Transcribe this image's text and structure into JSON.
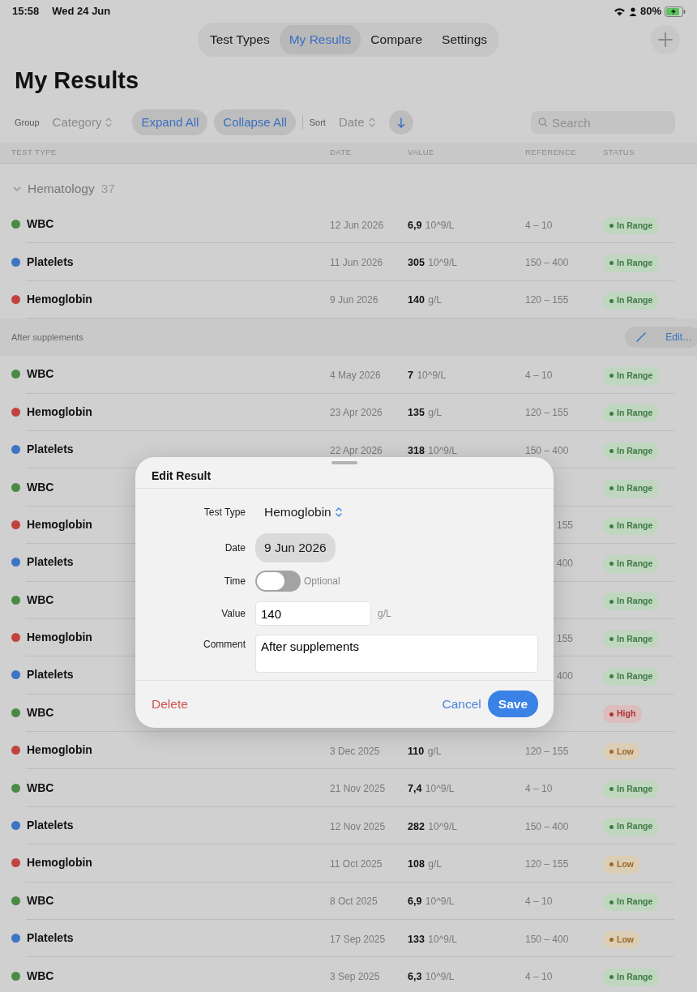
{
  "status_bar": {
    "time": "15:58",
    "date": "Wed 24 Jun",
    "battery": "80%"
  },
  "tabs": [
    {
      "label": "Test Types",
      "selected": false
    },
    {
      "label": "My Results",
      "selected": true
    },
    {
      "label": "Compare",
      "selected": false
    },
    {
      "label": "Settings",
      "selected": false
    }
  ],
  "page_title": "My Results",
  "toolbar": {
    "group_label": "Group",
    "group_value": "Category",
    "expand": "Expand All",
    "collapse": "Collapse All",
    "sort_label": "Sort",
    "sort_value": "Date",
    "search_placeholder": "Search"
  },
  "columns": [
    "TEST TYPE",
    "DATE",
    "VALUE",
    "REFERENCE",
    "STATUS"
  ],
  "group": {
    "name": "Hematology",
    "count": "37",
    "expanded": true
  },
  "rows": [
    {
      "kind": "full",
      "test": "WBC",
      "color": "#4a8a45",
      "date": "12 Jun 2026",
      "value": "6,9",
      "unit": "10^9/L",
      "reference": "4 – 10",
      "status": {
        "label": "In Range",
        "kind": "ok"
      }
    },
    {
      "kind": "full",
      "test": "Platelets",
      "color": "#3d74c4",
      "date": "11 Jun 2026",
      "value": "305",
      "unit": "10^9/L",
      "reference": "150 – 400",
      "status": {
        "label": "In Range",
        "kind": "ok"
      }
    },
    {
      "kind": "full",
      "test": "Hemoglobin",
      "color": "#c0443d",
      "date": "9 Jun 2026",
      "value": "140",
      "unit": "g/L",
      "reference": "120 – 155",
      "status": {
        "label": "In Range",
        "kind": "ok"
      },
      "note": {
        "text": "After supplements",
        "button": "Edit…"
      }
    },
    {
      "kind": "full",
      "test": "WBC",
      "color": "#4a8a45",
      "date": "4 May 2026",
      "value": "7",
      "unit": "10^9/L",
      "reference": "4 – 10",
      "status": {
        "label": "In Range",
        "kind": "ok"
      }
    },
    {
      "kind": "full",
      "test": "Hemoglobin",
      "color": "#c0443d",
      "date": "23 Apr 2026",
      "value": "135",
      "unit": "g/L",
      "reference": "120 – 155",
      "status": {
        "label": "In Range",
        "kind": "ok"
      }
    },
    {
      "kind": "full",
      "test": "Platelets",
      "color": "#3d74c4",
      "date": "22 Apr 2026",
      "value": "318",
      "unit": "10^9/L",
      "reference": "150 – 400",
      "status": {
        "label": "In Range",
        "kind": "ok"
      }
    },
    {
      "kind": "covered",
      "test": "WBC",
      "color": "#4a8a45",
      "status": {
        "label": "In Range",
        "kind": "ok"
      }
    },
    {
      "kind": "covered",
      "test": "Hemoglobin",
      "color": "#c0443d",
      "reference": "155",
      "status": {
        "label": "In Range",
        "kind": "ok"
      }
    },
    {
      "kind": "covered",
      "test": "Platelets",
      "color": "#3d74c4",
      "reference": "400",
      "status": {
        "label": "In Range",
        "kind": "ok"
      }
    },
    {
      "kind": "covered",
      "test": "WBC",
      "color": "#4a8a45",
      "status": {
        "label": "In Range",
        "kind": "ok"
      }
    },
    {
      "kind": "covered",
      "test": "Hemoglobin",
      "color": "#c0443d",
      "reference": "155",
      "status": {
        "label": "In Range",
        "kind": "ok"
      }
    },
    {
      "kind": "covered",
      "test": "Platelets",
      "color": "#3d74c4",
      "reference": "400",
      "status": {
        "label": "In Range",
        "kind": "ok"
      }
    },
    {
      "kind": "covered",
      "test": "WBC",
      "color": "#4a8a45",
      "status": {
        "label": "High",
        "kind": "high"
      }
    },
    {
      "kind": "full",
      "test": "Hemoglobin",
      "color": "#c0443d",
      "date": "3 Dec 2025",
      "value": "110",
      "unit": "g/L",
      "reference": "120 – 155",
      "status": {
        "label": "Low",
        "kind": "low"
      }
    },
    {
      "kind": "full",
      "test": "WBC",
      "color": "#4a8a45",
      "date": "21 Nov 2025",
      "value": "7,4",
      "unit": "10^9/L",
      "reference": "4 – 10",
      "status": {
        "label": "In Range",
        "kind": "ok"
      }
    },
    {
      "kind": "full",
      "test": "Platelets",
      "color": "#3d74c4",
      "date": "12 Nov 2025",
      "value": "282",
      "unit": "10^9/L",
      "reference": "150 – 400",
      "status": {
        "label": "In Range",
        "kind": "ok"
      }
    },
    {
      "kind": "full",
      "test": "Hemoglobin",
      "color": "#c0443d",
      "date": "11 Oct 2025",
      "value": "108",
      "unit": "g/L",
      "reference": "120 – 155",
      "status": {
        "label": "Low",
        "kind": "low"
      }
    },
    {
      "kind": "full",
      "test": "WBC",
      "color": "#4a8a45",
      "date": "8 Oct 2025",
      "value": "6,9",
      "unit": "10^9/L",
      "reference": "4 – 10",
      "status": {
        "label": "In Range",
        "kind": "ok"
      }
    },
    {
      "kind": "full",
      "test": "Platelets",
      "color": "#3d74c4",
      "date": "17 Sep 2025",
      "value": "133",
      "unit": "10^9/L",
      "reference": "150 – 400",
      "status": {
        "label": "Low",
        "kind": "low"
      }
    },
    {
      "kind": "full",
      "test": "WBC",
      "color": "#4a8a45",
      "date": "3 Sep 2025",
      "value": "6,3",
      "unit": "10^9/L",
      "reference": "4 – 10",
      "status": {
        "label": "In Range",
        "kind": "ok"
      }
    }
  ],
  "dialog": {
    "title": "Edit Result",
    "test_type": {
      "label": "Test Type",
      "value": "Hemoglobin"
    },
    "date": {
      "label": "Date",
      "value": "9 Jun 2026"
    },
    "time": {
      "label": "Time",
      "on": false,
      "hint": "Optional"
    },
    "value": {
      "label": "Value",
      "value": "140",
      "unit": "g/L"
    },
    "comment": {
      "label": "Comment",
      "value": "After supplements"
    },
    "delete": "Delete",
    "cancel": "Cancel",
    "save": "Save"
  }
}
